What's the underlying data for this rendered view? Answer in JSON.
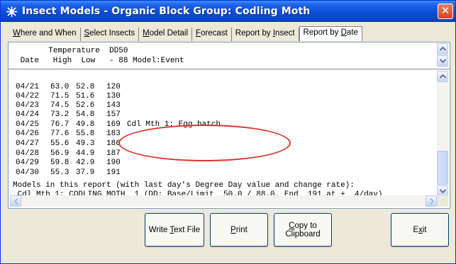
{
  "window": {
    "title": "Insect Models - Organic Block  Group: Codling Moth",
    "close_glyph": "✕"
  },
  "tabs": [
    {
      "pre": "",
      "ul": "W",
      "post": "here and When"
    },
    {
      "pre": "",
      "ul": "S",
      "post": "elect Insects"
    },
    {
      "pre": "",
      "ul": "M",
      "post": "odel Detail"
    },
    {
      "pre": "",
      "ul": "F",
      "post": "orecast"
    },
    {
      "pre": "Report by ",
      "ul": "I",
      "post": "nsect"
    },
    {
      "pre": "Report by ",
      "ul": "D",
      "post": "ate"
    }
  ],
  "active_tab_index": 5,
  "report": {
    "header_line1": "       Temperature  DD50",
    "header_line2": " Date   High  Low   - 88 Model:Event",
    "rows": [
      {
        "date": "04/21",
        "high": "63.0",
        "low": "52.8",
        "dd": "120",
        "event": ""
      },
      {
        "date": "04/22",
        "high": "71.5",
        "low": "51.6",
        "dd": "130",
        "event": ""
      },
      {
        "date": "04/23",
        "high": "74.5",
        "low": "52.6",
        "dd": "143",
        "event": ""
      },
      {
        "date": "04/24",
        "high": "73.2",
        "low": "54.8",
        "dd": "157",
        "event": ""
      },
      {
        "date": "04/25",
        "high": "76.7",
        "low": "49.8",
        "dd": "169",
        "event": "Cdl Mth 1: Egg hatch"
      },
      {
        "date": "04/26",
        "high": "77.6",
        "low": "55.8",
        "dd": "183",
        "event": ""
      },
      {
        "date": "04/27",
        "high": "55.6",
        "low": "49.3",
        "dd": "186",
        "event": ""
      },
      {
        "date": "04/28",
        "high": "56.9",
        "low": "44.9",
        "dd": "187",
        "event": ""
      },
      {
        "date": "04/29",
        "high": "59.8",
        "low": "42.9",
        "dd": "190",
        "event": ""
      },
      {
        "date": "04/30",
        "high": "55.3",
        "low": "37.9",
        "dd": "191",
        "event": ""
      }
    ],
    "models_line1": "Models in this report (with last day's Degree Day value and change rate):",
    "models_line2": " Cdl Mth 1: CODLING MOTH  1 (DD: Base/Limit  50.0 / 88.0, End  191 at +  4/day)"
  },
  "buttons": {
    "write_text_file": {
      "pre": "Write ",
      "ul": "T",
      "post": "ext File"
    },
    "print": {
      "pre": "",
      "ul": "P",
      "post": "rint"
    },
    "copy_line1": {
      "pre": "",
      "ul": "C",
      "post": "opy to"
    },
    "copy_line2": "Clipboard",
    "exit": {
      "pre": "E",
      "ul": "x",
      "post": "it"
    }
  },
  "colors": {
    "title_bar": "#0a4fd6",
    "highlight_ellipse": "#e0322b",
    "close_button": "#d4431f"
  },
  "icons": {
    "app": "insect-icon",
    "close": "close-icon"
  }
}
